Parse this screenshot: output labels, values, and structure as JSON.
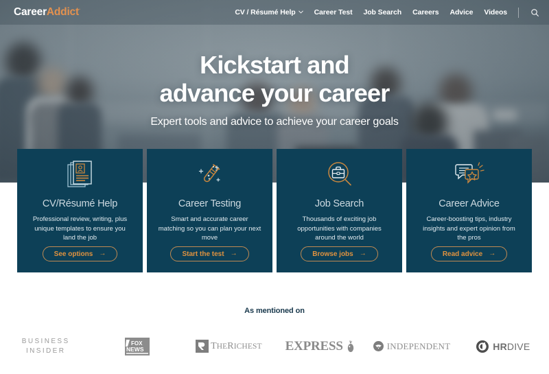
{
  "header": {
    "brand_primary": "Career",
    "brand_accent": "Addict",
    "brand_tm": "·",
    "nav": [
      {
        "label": "CV / Résumé Help",
        "has_dropdown": true,
        "icon": "chevron-down-icon"
      },
      {
        "label": "Career Test",
        "has_dropdown": false
      },
      {
        "label": "Job Search",
        "has_dropdown": false
      },
      {
        "label": "Careers",
        "has_dropdown": false
      },
      {
        "label": "Advice",
        "has_dropdown": false
      },
      {
        "label": "Videos",
        "has_dropdown": false
      }
    ],
    "search_icon": "search-icon"
  },
  "hero": {
    "title_line1": "Kickstart and",
    "title_line2": "advance your career",
    "subtitle": "Expert tools and advice to achieve your career goals"
  },
  "cards": [
    {
      "icon": "resume-documents-icon",
      "title": "CV/Résumé Help",
      "description": "Professional review, writing, plus unique templates to ensure you land the job",
      "button_label": "See options",
      "button_arrow": "→"
    },
    {
      "icon": "test-tube-icon",
      "title": "Career Testing",
      "description": "Smart and accurate career matching so you can plan your next move",
      "button_label": "Start the test",
      "button_arrow": "→"
    },
    {
      "icon": "briefcase-magnifier-icon",
      "title": "Job Search",
      "description": "Thousands of exciting job opportunities with companies around the world",
      "button_label": "Browse jobs",
      "button_arrow": "→"
    },
    {
      "icon": "speech-bubbles-star-icon",
      "title": "Career Advice",
      "description": "Career-boosting tips, industry insights and expert opinion from the pros",
      "button_label": "Read advice",
      "button_arrow": "→"
    }
  ],
  "mentioned": {
    "heading": "As mentioned on",
    "logos": [
      {
        "name": "business-insider",
        "line1": "BUSINESS",
        "line2": "INSIDER"
      },
      {
        "name": "fox-news",
        "line1": "FOX",
        "line2": "NEWS"
      },
      {
        "name": "the-richest",
        "mark": "R",
        "word_cap": "T",
        "word_rest": "HE",
        "word_cap2": "R",
        "word_rest2": "ICHEST"
      },
      {
        "name": "express",
        "word": "EXPRESS"
      },
      {
        "name": "independent",
        "word": "INDEPENDENT"
      },
      {
        "name": "hr-dive",
        "word_bold": "HR",
        "word_rest": "DIVE"
      }
    ]
  },
  "colors": {
    "card_bg": "#0d4057",
    "accent_orange": "#e0923f",
    "brand_accent": "#e3914f",
    "heading_navy": "#17374b",
    "card_title": "#ccd9e0"
  }
}
